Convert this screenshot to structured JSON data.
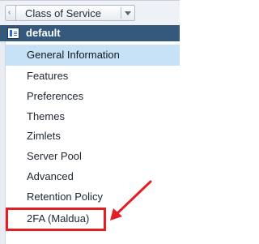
{
  "toolbar": {
    "back_icon": "chevron-left",
    "selector_label": "Class of Service",
    "dropdown_icon": "chevron-down"
  },
  "header": {
    "icon": "cos-icon",
    "title": "default"
  },
  "nav": {
    "items": [
      {
        "label": "General Information",
        "selected": true
      },
      {
        "label": "Features",
        "selected": false
      },
      {
        "label": "Preferences",
        "selected": false
      },
      {
        "label": "Themes",
        "selected": false
      },
      {
        "label": "Zimlets",
        "selected": false
      },
      {
        "label": "Server Pool",
        "selected": false
      },
      {
        "label": "Advanced",
        "selected": false
      },
      {
        "label": "Retention Policy",
        "selected": false
      },
      {
        "label": "2FA (Maldua)",
        "selected": false
      }
    ]
  },
  "annotation": {
    "color": "#e11f25"
  },
  "colors": {
    "header_bg": "#35597c",
    "selected_bg": "#c7e2f6"
  }
}
